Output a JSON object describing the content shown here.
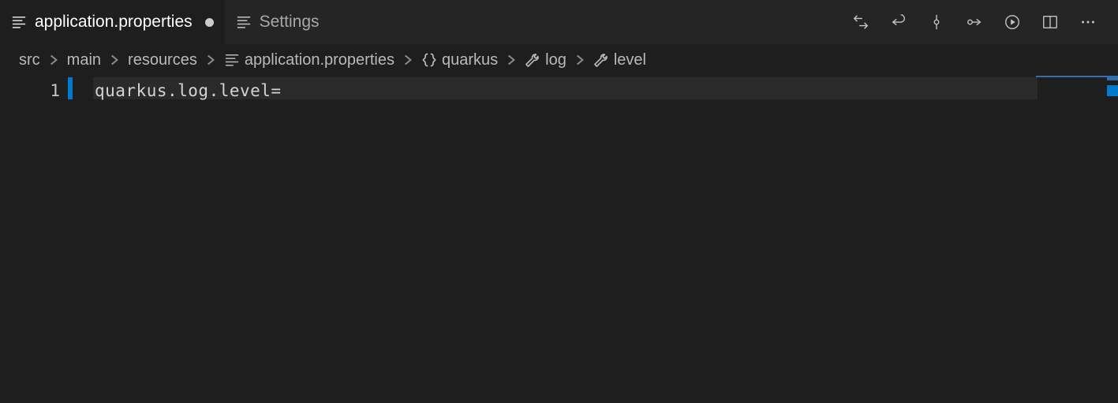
{
  "tabs": [
    {
      "label": "application.properties",
      "icon": "properties-icon",
      "dirty": true,
      "active": true
    },
    {
      "label": "Settings",
      "icon": "properties-icon",
      "dirty": false,
      "active": false
    }
  ],
  "breadcrumbs": {
    "items": [
      {
        "label": "src",
        "icon": null
      },
      {
        "label": "main",
        "icon": null
      },
      {
        "label": "resources",
        "icon": null
      },
      {
        "label": "application.properties",
        "icon": "properties-icon"
      },
      {
        "label": "quarkus",
        "icon": "braces-icon"
      },
      {
        "label": "log",
        "icon": "wrench-icon"
      },
      {
        "label": "level",
        "icon": "wrench-icon"
      }
    ]
  },
  "editor": {
    "line_numbers": [
      "1"
    ],
    "lines": [
      "quarkus.log.level="
    ]
  }
}
